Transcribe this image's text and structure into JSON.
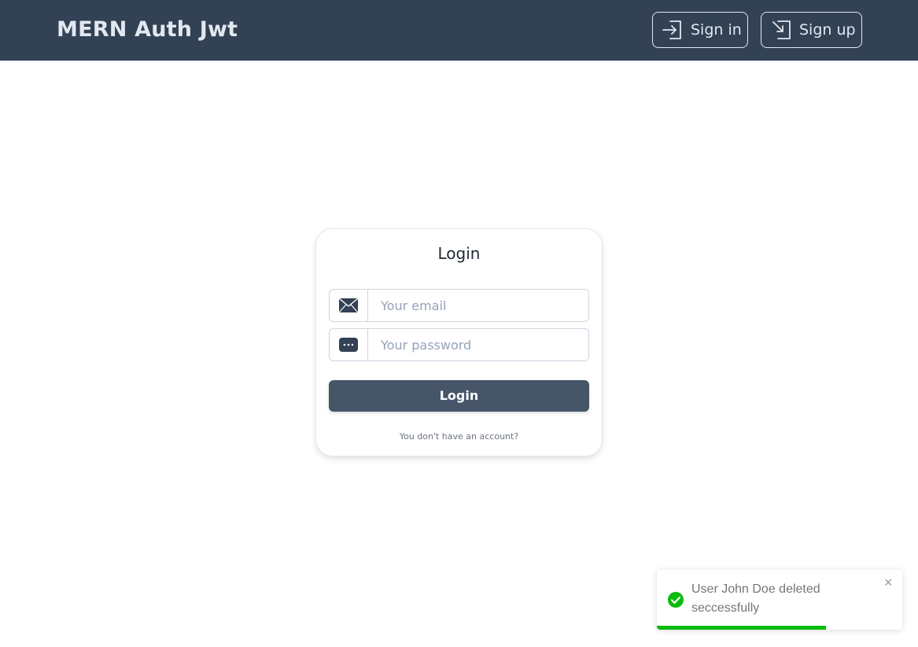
{
  "navbar": {
    "brand": "MERN Auth Jwt",
    "signin_label": "Sign in",
    "signup_label": "Sign up",
    "signin_icon": "sign-in-icon",
    "signup_icon": "sign-up-icon"
  },
  "login_card": {
    "title": "Login",
    "email_placeholder": "Your email",
    "password_placeholder": "Your password",
    "email_icon": "envelope-icon",
    "password_icon": "password-dots-icon",
    "submit_label": "Login",
    "no_account_text": "You don't have an account?"
  },
  "toast": {
    "message": "User John Doe deleted seccessfully",
    "close_symbol": "×",
    "status": "success",
    "progress": 0.69
  },
  "colors": {
    "navbar_bg": "#334155",
    "button_bg": "#475569",
    "success": "#07bc0c"
  }
}
